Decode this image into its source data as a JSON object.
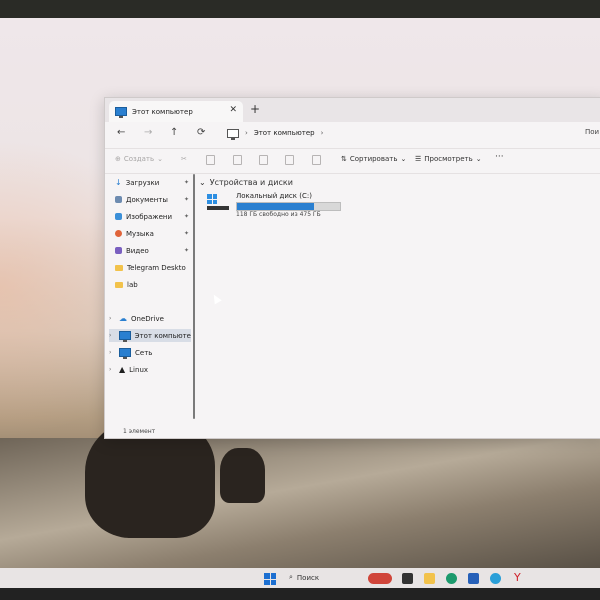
{
  "window": {
    "tab_title": "Этот компьютер",
    "close_glyph": "✕",
    "new_tab_glyph": "+"
  },
  "nav": {
    "back": "←",
    "forward": "→",
    "up": "↑",
    "refresh": "⟳",
    "crumb": "Этот компьютер",
    "crumb_sep": "›",
    "search_cut": "Пои"
  },
  "toolbar": {
    "create": "Создать",
    "sort": "Сортировать",
    "view": "Просмотреть",
    "more": "···"
  },
  "sidebar": {
    "items": [
      {
        "label": "Загрузки",
        "icon": "download-icon",
        "pinned": true
      },
      {
        "label": "Документы",
        "icon": "documents-icon",
        "pinned": true
      },
      {
        "label": "Изображени",
        "icon": "pictures-icon",
        "pinned": true
      },
      {
        "label": "Музыка",
        "icon": "music-icon",
        "pinned": true
      },
      {
        "label": "Видео",
        "icon": "video-icon",
        "pinned": true
      },
      {
        "label": "Telegram Deskto",
        "icon": "folder-icon",
        "pinned": false
      },
      {
        "label": "lab",
        "icon": "folder-icon",
        "pinned": false
      }
    ],
    "tree": [
      {
        "label": "OneDrive",
        "icon": "cloud-icon"
      },
      {
        "label": "Этот компьюте",
        "icon": "computer-icon",
        "selected": true
      },
      {
        "label": "Сеть",
        "icon": "network-icon"
      },
      {
        "label": "Linux",
        "icon": "linux-icon"
      }
    ]
  },
  "content": {
    "group_title": "Устройства и диски",
    "drive_name": "Локальный диск (C:)",
    "drive_free": "118 ГБ свободно из 475 ГБ",
    "used_fraction": 0.75
  },
  "status": {
    "count": "1 элемент"
  },
  "taskbar": {
    "search_label": "Поиск"
  },
  "colors": {
    "accent": "#2a7fd0",
    "folder": "#f2c24b"
  }
}
